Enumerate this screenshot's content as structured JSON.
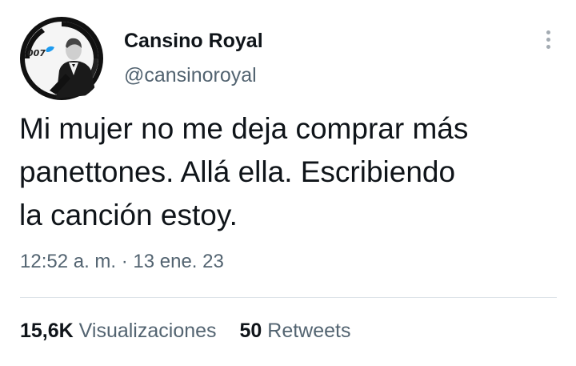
{
  "author": {
    "display_name": "Cansino Royal",
    "handle": "@cansinoroyal",
    "avatar_text": "007"
  },
  "tweet": {
    "text": "Mi mujer no me deja comprar más\npanettones. Allá ella. Escribiendo\nla canción estoy.",
    "time": "12:52 a. m. · 13 ene. 23"
  },
  "stats": {
    "views_count": "15,6K",
    "views_label": "Visualizaciones",
    "retweets_count": "50",
    "retweets_label": "Retweets"
  },
  "icons": {
    "more": "more-vertical-icon"
  },
  "colors": {
    "text_primary": "#0f1419",
    "text_secondary": "#536471",
    "divider": "#dde3e8",
    "brand_blue": "#1d9bf0"
  }
}
